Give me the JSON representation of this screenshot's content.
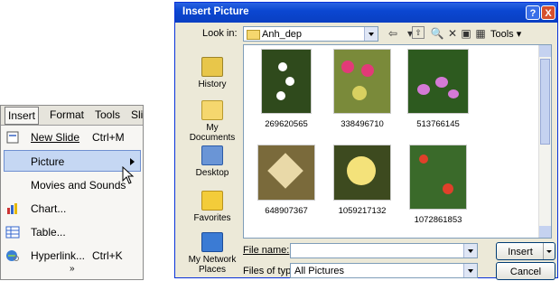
{
  "menu": {
    "bar": [
      {
        "label": "Insert"
      },
      {
        "label": "Format"
      },
      {
        "label": "Tools"
      },
      {
        "label": "Sli"
      }
    ],
    "items": [
      {
        "label": "New Slide",
        "shortcut": "Ctrl+M",
        "icon": "new-slide-icon"
      },
      {
        "label": "Picture",
        "shortcut": "",
        "icon": "",
        "highlighted": true
      },
      {
        "label": "Movies and Sounds",
        "shortcut": "",
        "icon": ""
      },
      {
        "label": "Chart...",
        "shortcut": "",
        "icon": "chart-icon"
      },
      {
        "label": "Table...",
        "shortcut": "",
        "icon": "table-icon"
      },
      {
        "label": "Hyperlink...",
        "shortcut": "Ctrl+K",
        "icon": "hyperlink-icon"
      }
    ],
    "more": "»"
  },
  "dialog": {
    "title": "Insert Picture",
    "help_label": "?",
    "close_label": "X",
    "look_in_label": "Look in:",
    "look_in_value": "Anh_dep",
    "tools_label": "Tools",
    "places": [
      {
        "label": "History",
        "color": "#e8c64a"
      },
      {
        "label": "My Documents",
        "color": "#f5d76e"
      },
      {
        "label": "Desktop",
        "color": "#6a95d6"
      },
      {
        "label": "Favorites",
        "color": "#f3cc3a"
      },
      {
        "label": "My Network Places",
        "color": "#3b7bd4"
      }
    ],
    "files": [
      {
        "name": "269620565",
        "bg": "#2f4a1c",
        "fg": "#ffffff"
      },
      {
        "name": "338496710",
        "bg": "#7a8a3a",
        "fg": "#e23a78"
      },
      {
        "name": "513766145",
        "bg": "#2d5a1f",
        "fg": "#d47ad6"
      },
      {
        "name": "648907367",
        "bg": "#7a6a3b",
        "fg": "#e9d9a8"
      },
      {
        "name": "1059217132",
        "bg": "#3d4a1f",
        "fg": "#f4e27a"
      },
      {
        "name": "1072861853",
        "bg": "#3a6a2a",
        "fg": "#e0402a"
      }
    ],
    "file_name_label": "File name:",
    "file_name_value": "",
    "files_of_type_label": "Files of type:",
    "files_of_type_value": "All Pictures",
    "insert_label": "Insert",
    "cancel_label": "Cancel"
  }
}
